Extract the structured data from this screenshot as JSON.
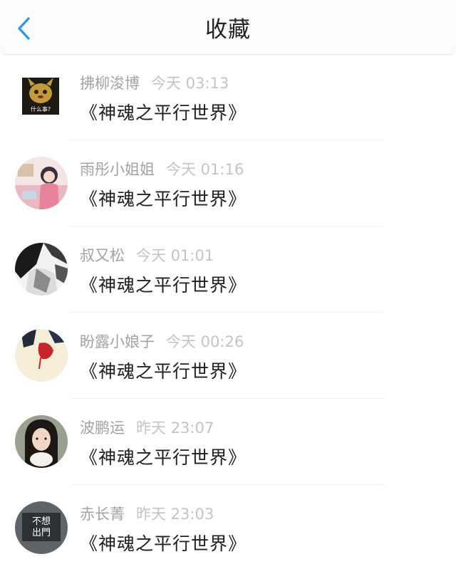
{
  "header": {
    "title": "收藏",
    "back_icon": "chevron-left-icon",
    "accent_color": "#2f95e6"
  },
  "items": [
    {
      "name": "拂柳浚博",
      "time": "今天 03:13",
      "content": "《神魂之平行世界》",
      "avatar_text": "什么事?"
    },
    {
      "name": "雨彤小姐姐",
      "time": "今天 01:16",
      "content": "《神魂之平行世界》"
    },
    {
      "name": "叔又松",
      "time": "今天 01:01",
      "content": "《神魂之平行世界》"
    },
    {
      "name": "盼露小娘子",
      "time": "今天 00:26",
      "content": "《神魂之平行世界》"
    },
    {
      "name": "波鹏运",
      "time": "昨天 23:07",
      "content": "《神魂之平行世界》"
    },
    {
      "name": "赤长菁",
      "time": "昨天 23:03",
      "content": "《神魂之平行世界》",
      "avatar_text": "不想出門"
    }
  ]
}
